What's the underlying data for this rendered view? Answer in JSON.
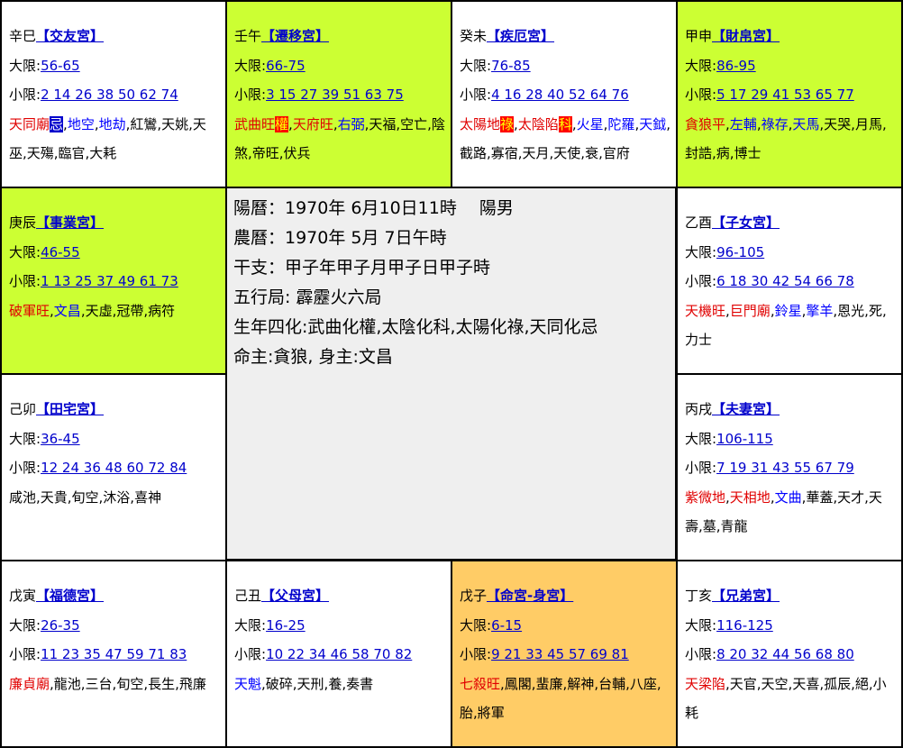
{
  "palaces": {
    "p0": {
      "stem_branch": "辛巳",
      "name": "【交友宮】",
      "major_label": "大限:",
      "major": "56-65",
      "minor_label": "小限:",
      "minor": "2 14 26 38 50 62 74",
      "stars": [
        {
          "t": "天同廟",
          "c": "red"
        },
        {
          "t": "忌",
          "c": "ji"
        },
        {
          "t": ",",
          "c": "black"
        },
        {
          "t": "地空",
          "c": "blue"
        },
        {
          "t": ",",
          "c": "black"
        },
        {
          "t": "地劫",
          "c": "blue"
        },
        {
          "t": ",紅鸞,天姚,天巫,天殤,臨官,大耗",
          "c": "black"
        }
      ]
    },
    "p1": {
      "stem_branch": "壬午",
      "name": "【遷移宮】",
      "major_label": "大限:",
      "major": "66-75",
      "minor_label": "小限:",
      "minor": "3 15 27 39 51 63 75",
      "stars": [
        {
          "t": "武曲旺",
          "c": "red"
        },
        {
          "t": "權",
          "c": "hl"
        },
        {
          "t": ",",
          "c": "black"
        },
        {
          "t": "天府旺",
          "c": "red"
        },
        {
          "t": ",",
          "c": "black"
        },
        {
          "t": "右弼",
          "c": "blue"
        },
        {
          "t": ",天福,空亡,陰煞,帝旺,伏兵",
          "c": "black"
        }
      ]
    },
    "p2": {
      "stem_branch": "癸未",
      "name": "【疾厄宮】",
      "major_label": "大限:",
      "major": "76-85",
      "minor_label": "小限:",
      "minor": "4 16 28 40 52 64 76",
      "stars": [
        {
          "t": "太陽地",
          "c": "red"
        },
        {
          "t": "祿",
          "c": "hl"
        },
        {
          "t": ",",
          "c": "black"
        },
        {
          "t": "太陰陷",
          "c": "red"
        },
        {
          "t": "科",
          "c": "hl"
        },
        {
          "t": ",",
          "c": "black"
        },
        {
          "t": "火星",
          "c": "blue"
        },
        {
          "t": ",",
          "c": "black"
        },
        {
          "t": "陀羅",
          "c": "blue"
        },
        {
          "t": ",",
          "c": "black"
        },
        {
          "t": "天鉞",
          "c": "blue"
        },
        {
          "t": ",截路,寡宿,天月,天使,衰,官府",
          "c": "black"
        }
      ]
    },
    "p3": {
      "stem_branch": "甲申",
      "name": "【財帛宮】",
      "major_label": "大限:",
      "major": "86-95",
      "minor_label": "小限:",
      "minor": "5 17 29 41 53 65 77",
      "stars": [
        {
          "t": "貪狼平",
          "c": "red"
        },
        {
          "t": ",",
          "c": "black"
        },
        {
          "t": "左輔",
          "c": "blue"
        },
        {
          "t": ",",
          "c": "black"
        },
        {
          "t": "祿存",
          "c": "blue"
        },
        {
          "t": ",",
          "c": "black"
        },
        {
          "t": "天馬",
          "c": "blue"
        },
        {
          "t": ",天哭,月馬,封誥,病,博士",
          "c": "black"
        }
      ]
    },
    "p4": {
      "stem_branch": "庚辰",
      "name": "【事業宮】",
      "major_label": "大限:",
      "major": "46-55",
      "minor_label": "小限:",
      "minor": "1 13 25 37 49 61 73",
      "stars": [
        {
          "t": "破軍旺",
          "c": "red"
        },
        {
          "t": ",",
          "c": "black"
        },
        {
          "t": "文昌",
          "c": "blue"
        },
        {
          "t": ",天虛,冠帶,病符",
          "c": "black"
        }
      ]
    },
    "p5": {
      "stem_branch": "乙酉",
      "name": "【子女宮】",
      "major_label": "大限:",
      "major": "96-105",
      "minor_label": "小限:",
      "minor": "6 18 30 42 54 66 78",
      "stars": [
        {
          "t": "天機旺",
          "c": "red"
        },
        {
          "t": ",",
          "c": "black"
        },
        {
          "t": "巨門廟",
          "c": "red"
        },
        {
          "t": ",",
          "c": "black"
        },
        {
          "t": "鈴星",
          "c": "blue"
        },
        {
          "t": ",",
          "c": "black"
        },
        {
          "t": "擎羊",
          "c": "blue"
        },
        {
          "t": ",恩光,死,力士",
          "c": "black"
        }
      ]
    },
    "p6": {
      "stem_branch": "己卯",
      "name": "【田宅宮】",
      "major_label": "大限:",
      "major": "36-45",
      "minor_label": "小限:",
      "minor": "12 24 36 48 60 72 84",
      "stars": [
        {
          "t": "咸池,天貴,旬空,沐浴,喜神",
          "c": "black"
        }
      ]
    },
    "p7": {
      "stem_branch": "丙戌",
      "name": "【夫妻宮】",
      "major_label": "大限:",
      "major": "106-115",
      "minor_label": "小限:",
      "minor": "7 19 31 43 55 67 79",
      "stars": [
        {
          "t": "紫微地",
          "c": "red"
        },
        {
          "t": ",",
          "c": "black"
        },
        {
          "t": "天相地",
          "c": "red"
        },
        {
          "t": ",",
          "c": "black"
        },
        {
          "t": "文曲",
          "c": "blue"
        },
        {
          "t": ",華蓋,天才,天壽,墓,青龍",
          "c": "black"
        }
      ]
    },
    "p8": {
      "stem_branch": "戊寅",
      "name": "【福德宮】",
      "major_label": "大限:",
      "major": "26-35",
      "minor_label": "小限:",
      "minor": "11 23 35 47 59 71 83",
      "stars": [
        {
          "t": "廉貞廟",
          "c": "red"
        },
        {
          "t": ",龍池,三台,旬空,長生,飛廉",
          "c": "black"
        }
      ]
    },
    "p9": {
      "stem_branch": "己丑",
      "name": "【父母宮】",
      "major_label": "大限:",
      "major": "16-25",
      "minor_label": "小限:",
      "minor": "10 22 34 46 58 70 82",
      "stars": [
        {
          "t": "天魁",
          "c": "blue"
        },
        {
          "t": ",破碎,天刑,養,奏書",
          "c": "black"
        }
      ]
    },
    "p10": {
      "stem_branch": "戊子",
      "name": "【命宮-身宮】",
      "major_label": "大限:",
      "major": "6-15",
      "minor_label": "小限:",
      "minor": "9 21 33 45 57 69 81",
      "stars": [
        {
          "t": "七殺旺",
          "c": "red"
        },
        {
          "t": ",鳳閣,蜚廉,解神,台輔,八座,胎,將軍",
          "c": "black"
        }
      ]
    },
    "p11": {
      "stem_branch": "丁亥",
      "name": "【兄弟宮】",
      "major_label": "大限:",
      "major": "116-125",
      "minor_label": "小限:",
      "minor": "8 20 32 44 56 68 80",
      "stars": [
        {
          "t": "天梁陷",
          "c": "red"
        },
        {
          "t": ",天官,天空,天喜,孤辰,絕,小耗",
          "c": "black"
        }
      ]
    }
  },
  "center": {
    "solar": "陽曆：1970年 6月10日11時 　陽男",
    "lunar": "農曆：1970年 5月 7日午時",
    "ganzhi": "干支：甲子年甲子月甲子日甲子時",
    "wuxing": "五行局: 霹靂火六局",
    "sihua": "生年四化:武曲化權,太陰化科,太陽化祿,天同化忌",
    "master": "命主:貪狼, 身主:文昌"
  },
  "colors": {
    "lime_bg": "#ccff33",
    "orange_bg": "#ffcc66",
    "center_bg": "#efefef",
    "star_red": "#e00000",
    "star_blue": "#0000ff",
    "link_blue": "#0000cc"
  }
}
